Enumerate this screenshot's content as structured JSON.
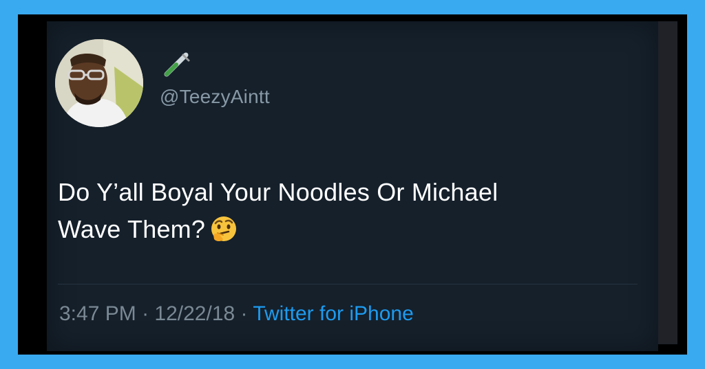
{
  "tweet": {
    "handle": "@TeezyAintt",
    "text_line1": "Do Y’all Boyal Your Noodles Or Michael",
    "text_line2": "Wave Them?",
    "time": "3:47 PM",
    "date": "12/22/18",
    "separator": " · ",
    "source": "Twitter for iPhone"
  },
  "icons": {
    "avatar": "avatar-photo",
    "badge": "test-tube-icon",
    "emoji": "thinking-face-emoji"
  },
  "colors": {
    "page_border": "#3aaaf0",
    "card_bg": "#15202b",
    "link": "#1d9bf0",
    "muted": "#8899a6"
  }
}
